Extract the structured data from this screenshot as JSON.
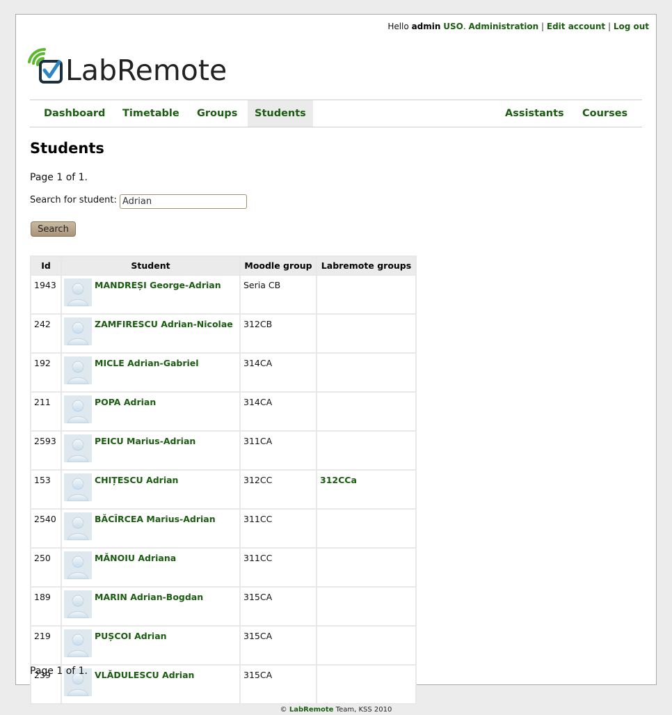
{
  "userbar": {
    "hello": "Hello",
    "username": "admin",
    "group": "USO",
    "dot": ".",
    "administration": "Administration",
    "separator": "|",
    "edit_account": "Edit account",
    "log_out": "Log out"
  },
  "logo": {
    "text": "LabRemote"
  },
  "nav": {
    "left": [
      "Dashboard",
      "Timetable",
      "Groups",
      "Students"
    ],
    "right": [
      "Assistants",
      "Courses"
    ],
    "active": "Students"
  },
  "page": {
    "title": "Students",
    "page_info_top": "Page 1 of 1.",
    "page_info_bottom": "Page 1 of 1."
  },
  "search": {
    "label": "Search for student:",
    "value": "Adrian",
    "button": "Search"
  },
  "table": {
    "headers": [
      "Id",
      "Student",
      "Moodle group",
      "Labremote groups"
    ],
    "rows": [
      {
        "id": "1943",
        "name": "MANDREȘI George-Adrian",
        "moodle": "Seria CB",
        "labremote": ""
      },
      {
        "id": "242",
        "name": "ZAMFIRESCU Adrian-Nicolae",
        "moodle": "312CB",
        "labremote": ""
      },
      {
        "id": "192",
        "name": "MICLE Adrian-Gabriel",
        "moodle": "314CA",
        "labremote": ""
      },
      {
        "id": "211",
        "name": "POPA Adrian",
        "moodle": "314CA",
        "labremote": ""
      },
      {
        "id": "2593",
        "name": "PEICU Marius-Adrian",
        "moodle": "311CA",
        "labremote": ""
      },
      {
        "id": "153",
        "name": "CHIȚESCU Adrian",
        "moodle": "312CC",
        "labremote": "312CCa"
      },
      {
        "id": "2540",
        "name": "BĂCÎRCEA Marius-Adrian",
        "moodle": "311CC",
        "labremote": ""
      },
      {
        "id": "250",
        "name": "MĂNOIU Adriana",
        "moodle": "311CC",
        "labremote": ""
      },
      {
        "id": "189",
        "name": "MARIN Adrian-Bogdan",
        "moodle": "315CA",
        "labremote": ""
      },
      {
        "id": "219",
        "name": "PUȘCOI Adrian",
        "moodle": "315CA",
        "labremote": ""
      },
      {
        "id": "239",
        "name": "VLĂDULESCU Adrian",
        "moodle": "315CA",
        "labremote": ""
      }
    ]
  },
  "footer": {
    "copyright": "©",
    "brand": "LabRemote",
    "rest": "Team, KSS 2010"
  },
  "colors": {
    "link": "#1a5c10",
    "page_background": "#ececec",
    "nav_active": "#ebebeb",
    "button": "#b8a48a"
  },
  "icons": {
    "logo": "signal-checkbox-logo-icon",
    "avatar": "default-user-avatar-icon"
  }
}
